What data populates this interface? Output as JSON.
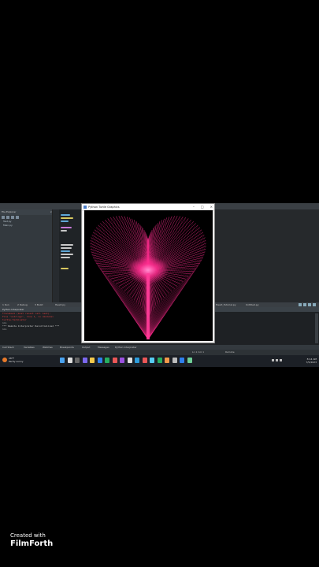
{
  "ide": {
    "project_panel_title": "File Explorer",
    "tree": [
      "Test.py",
      "Main.py",
      "Heart.py"
    ],
    "tabs": [
      "1 Run",
      "2 Debug",
      "3 Build",
      "Heart.py",
      "main.py"
    ],
    "right_tabs": [
      "Heart_Tutorial.py",
      "Untitled.py"
    ],
    "console_title": "Python Interpreter",
    "console_lines": [
      {
        "text": "Traceback (most recent call last):",
        "color": "#e04040"
      },
      {
        "text": "  File \"<string>\", line 1, in <module>",
        "color": "#e04040"
      },
      {
        "text": "  turtle.Terminator",
        "color": "#e04040"
      },
      {
        "text": ">>>",
        "color": "#c8c8c8"
      },
      {
        "text": "*** Remote Interpreter Reinitialized ***",
        "color": "#c8c8c8"
      },
      {
        "text": ">>>",
        "color": "#c8c8c8"
      }
    ],
    "bottom_tabs": [
      "Call Stack",
      "Variables",
      "Watches",
      "Breakpoints",
      "Output",
      "Messages",
      "Python Interpreter"
    ],
    "status": {
      "position": "Ln 1 Col 1",
      "mode": "Remote"
    }
  },
  "turtle_window": {
    "title": "Python Turtle Graphics"
  },
  "taskbar": {
    "weather_temp": "28°F",
    "weather_desc": "Partly sunny",
    "time": "8:14 AM",
    "date": "7/5/2023",
    "lang": "ENG"
  },
  "watermark": {
    "line1": "Created with",
    "line2": "FilmForth"
  },
  "colors": {
    "heart": "#ff2d8f",
    "taskbar": "#1c2026",
    "ide_bg": "#2b2f33"
  }
}
